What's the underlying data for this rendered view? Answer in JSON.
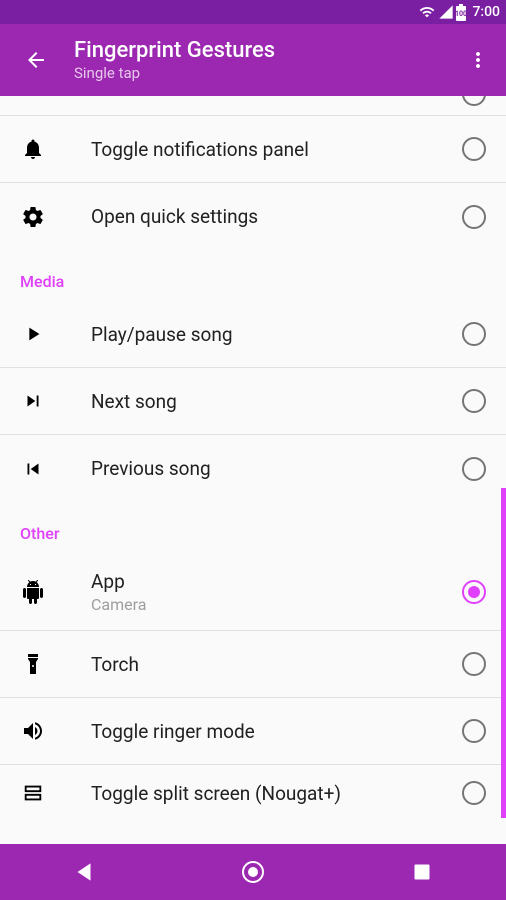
{
  "status": {
    "time": "7:00",
    "battery": "100"
  },
  "header": {
    "title": "Fingerprint Gestures",
    "subtitle": "Single tap"
  },
  "rows": {
    "notifications": "Toggle notifications panel",
    "quicksettings": "Open quick settings",
    "playpause": "Play/pause song",
    "nextsong": "Next song",
    "prevsong": "Previous song",
    "app": "App",
    "app_sub": "Camera",
    "torch": "Torch",
    "ringer": "Toggle ringer mode",
    "splitscreen": "Toggle split screen (Nougat+)"
  },
  "sections": {
    "media": "Media",
    "other": "Other"
  }
}
